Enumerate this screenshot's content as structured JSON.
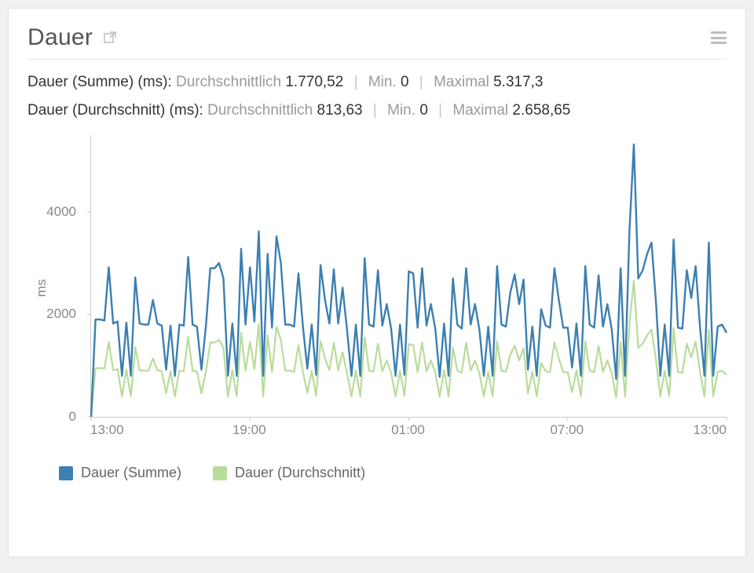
{
  "header": {
    "title": "Dauer"
  },
  "stats": [
    {
      "name": "Dauer (Summe) (ms):",
      "avg_label": "Durchschnittlich",
      "avg_value": "1.770,52",
      "min_label": "Min.",
      "min_value": "0",
      "max_label": "Maximal",
      "max_value": "5.317,3"
    },
    {
      "name": "Dauer (Durchschnitt) (ms):",
      "avg_label": "Durchschnittlich",
      "avg_value": "813,63",
      "min_label": "Min.",
      "min_value": "0",
      "max_label": "Maximal",
      "max_value": "2.658,65"
    }
  ],
  "legend": {
    "series1": {
      "label": "Dauer (Summe)",
      "color": "#3c7fb1"
    },
    "series2": {
      "label": "Dauer (Durchschnitt)",
      "color": "#b9dc9a"
    }
  },
  "axis": {
    "ylabel": "ms",
    "yticks": [
      0,
      2000,
      4000
    ],
    "xticks": [
      "13:00",
      "19:00",
      "01:00",
      "07:00",
      "13:00"
    ]
  },
  "chart_data": {
    "type": "line",
    "title": "Dauer",
    "xlabel": "",
    "ylabel": "ms",
    "ylim": [
      0,
      5500
    ],
    "xlim": [
      0,
      144
    ],
    "x_tick_labels": [
      "13:00",
      "19:00",
      "01:00",
      "07:00",
      "13:00"
    ],
    "x": [
      0,
      1,
      2,
      3,
      4,
      5,
      6,
      7,
      8,
      9,
      10,
      11,
      12,
      13,
      14,
      15,
      16,
      17,
      18,
      19,
      20,
      21,
      22,
      23,
      24,
      25,
      26,
      27,
      28,
      29,
      30,
      31,
      32,
      33,
      34,
      35,
      36,
      37,
      38,
      39,
      40,
      41,
      42,
      43,
      44,
      45,
      46,
      47,
      48,
      49,
      50,
      51,
      52,
      53,
      54,
      55,
      56,
      57,
      58,
      59,
      60,
      61,
      62,
      63,
      64,
      65,
      66,
      67,
      68,
      69,
      70,
      71,
      72,
      73,
      74,
      75,
      76,
      77,
      78,
      79,
      80,
      81,
      82,
      83,
      84,
      85,
      86,
      87,
      88,
      89,
      90,
      91,
      92,
      93,
      94,
      95,
      96,
      97,
      98,
      99,
      100,
      101,
      102,
      103,
      104,
      105,
      106,
      107,
      108,
      109,
      110,
      111,
      112,
      113,
      114,
      115,
      116,
      117,
      118,
      119,
      120,
      121,
      122,
      123,
      124,
      125,
      126,
      127,
      128,
      129,
      130,
      131,
      132,
      133,
      134,
      135,
      136,
      137,
      138,
      139,
      140,
      141,
      142,
      143,
      144
    ],
    "series": [
      {
        "name": "Dauer (Summe)",
        "color": "#3c7fb1",
        "values": [
          0,
          1900,
          1900,
          1880,
          2920,
          1820,
          1860,
          800,
          1840,
          800,
          2720,
          1820,
          1800,
          1800,
          2280,
          1820,
          1780,
          920,
          1780,
          800,
          1800,
          1780,
          3120,
          1800,
          1760,
          920,
          1760,
          2900,
          2900,
          3000,
          2700,
          800,
          1820,
          800,
          3280,
          1800,
          2920,
          1860,
          3620,
          800,
          3180,
          1740,
          3520,
          3000,
          1800,
          1800,
          1760,
          2800,
          1760,
          940,
          1800,
          820,
          2960,
          2280,
          1820,
          2880,
          1820,
          2520,
          1700,
          800,
          1800,
          800,
          3100,
          1800,
          1760,
          2860,
          1780,
          2200,
          1720,
          800,
          1800,
          820,
          2840,
          2800,
          1740,
          2900,
          1780,
          2200,
          1720,
          780,
          1820,
          800,
          2700,
          1800,
          1720,
          2900,
          1800,
          2200,
          1700,
          800,
          1760,
          800,
          2940,
          1800,
          1760,
          2420,
          2780,
          2200,
          2680,
          920,
          1760,
          800,
          2100,
          1780,
          1740,
          2900,
          2280,
          1740,
          1740,
          960,
          1820,
          800,
          2940,
          1800,
          1740,
          2760,
          1760,
          2200,
          1700,
          740,
          2900,
          800,
          3620,
          5317,
          2700,
          2860,
          3180,
          3400,
          2260,
          800,
          1800,
          800,
          3460,
          1740,
          1720,
          2860,
          2320,
          2940,
          1740,
          800,
          3400,
          800,
          1760,
          1800,
          1640
        ],
        "avg": 1770.52,
        "min": 0,
        "max": 5317.3
      },
      {
        "name": "Dauer (Durchschnitt)",
        "color": "#b9dc9a",
        "values": [
          0,
          950,
          950,
          940,
          1460,
          910,
          930,
          400,
          920,
          400,
          1360,
          910,
          900,
          900,
          1140,
          910,
          890,
          460,
          890,
          400,
          900,
          890,
          1560,
          900,
          880,
          460,
          880,
          1450,
          1450,
          1500,
          1350,
          400,
          910,
          400,
          1640,
          900,
          1460,
          930,
          1810,
          400,
          1590,
          870,
          1760,
          1500,
          900,
          900,
          880,
          1400,
          880,
          470,
          900,
          410,
          1480,
          1140,
          910,
          1440,
          910,
          1260,
          850,
          400,
          900,
          400,
          1550,
          900,
          880,
          1430,
          890,
          1100,
          860,
          400,
          900,
          410,
          1420,
          1400,
          870,
          1450,
          890,
          1100,
          860,
          390,
          910,
          400,
          1350,
          900,
          860,
          1450,
          900,
          1100,
          850,
          400,
          880,
          400,
          1470,
          900,
          880,
          1210,
          1390,
          1100,
          1340,
          460,
          880,
          400,
          1050,
          890,
          870,
          1450,
          1140,
          870,
          870,
          480,
          910,
          400,
          1470,
          900,
          870,
          1380,
          880,
          1100,
          850,
          370,
          1450,
          400,
          1810,
          2658,
          1350,
          1430,
          1590,
          1700,
          1130,
          400,
          900,
          400,
          1730,
          870,
          860,
          1430,
          1160,
          1470,
          870,
          400,
          1700,
          400,
          880,
          900,
          820
        ],
        "avg": 813.63,
        "min": 0,
        "max": 2658.65
      }
    ]
  }
}
